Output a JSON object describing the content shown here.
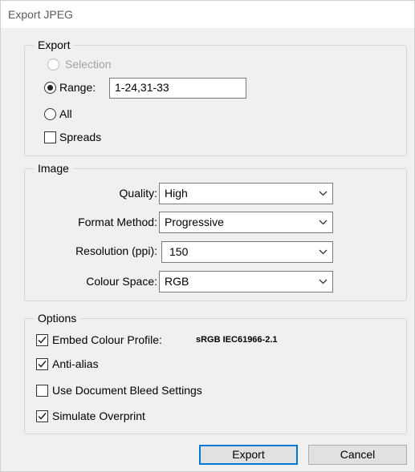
{
  "window": {
    "title": "Export JPEG"
  },
  "export_group": {
    "legend": "Export",
    "selection_label": "Selection",
    "range_label": "Range:",
    "range_value": "1-24,31-33",
    "all_label": "All",
    "spreads_label": "Spreads",
    "selected": "range",
    "spreads_checked": false
  },
  "image_group": {
    "legend": "Image",
    "quality": {
      "label": "Quality:",
      "value": "High"
    },
    "format_method": {
      "label": "Format Method:",
      "value": "Progressive"
    },
    "resolution": {
      "label": "Resolution (ppi):",
      "value": "150"
    },
    "colour_space": {
      "label": "Colour Space:",
      "value": "RGB"
    }
  },
  "options_group": {
    "legend": "Options",
    "embed_profile": {
      "label": "Embed Colour Profile:",
      "checked": true,
      "profile_value": "sRGB IEC61966-2.1"
    },
    "anti_alias": {
      "label": "Anti-alias",
      "checked": true
    },
    "bleed": {
      "label": "Use Document Bleed Settings",
      "checked": false
    },
    "overprint": {
      "label": "Simulate Overprint",
      "checked": true
    }
  },
  "buttons": {
    "export": "Export",
    "cancel": "Cancel"
  },
  "colors": {
    "dialog_bg": "#f0f0f0",
    "default_button_border": "#0078d7",
    "disabled_text": "#a3a3a3"
  }
}
